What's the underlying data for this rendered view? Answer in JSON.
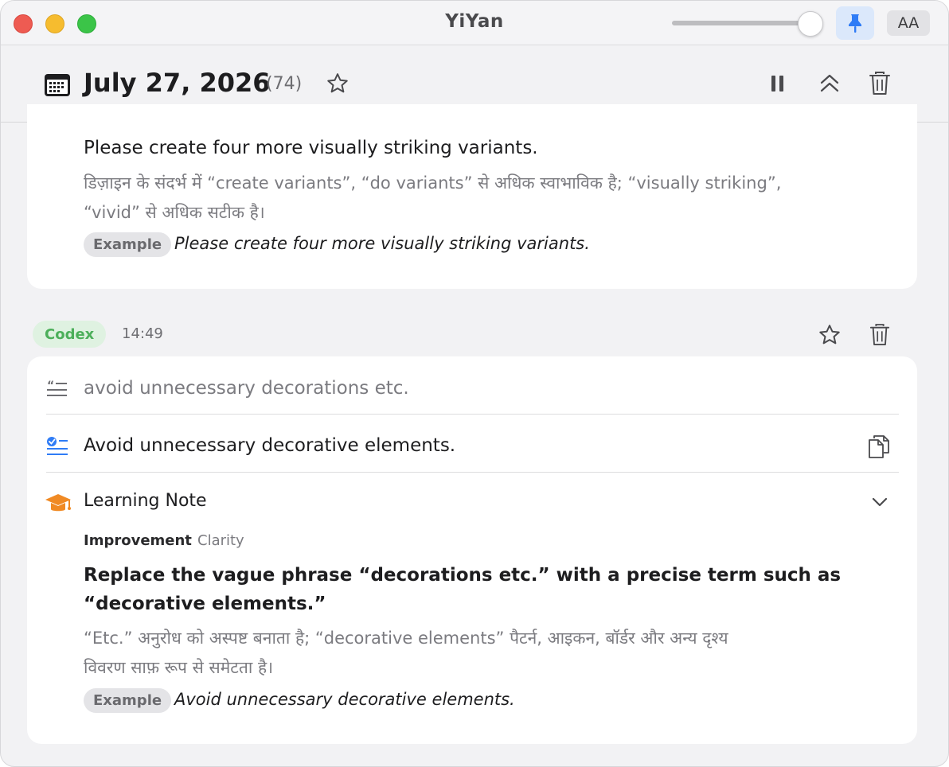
{
  "window": {
    "title": "YiYan"
  },
  "header": {
    "date": "July 27, 2026",
    "count": "(74)"
  },
  "previous_entry": {
    "text": "Please create four more visually striking variants.",
    "note_line1": "डिज़ाइन के संदर्भ में “create variants”, “do variants” से अधिक स्वाभाविक है; “visually striking”,",
    "note_line2": "“vivid” से अधिक सटीक है।",
    "example_badge": "Example",
    "example_text": "Please create four more visually striking variants."
  },
  "entry": {
    "source_badge": "Codex",
    "time": "14:49",
    "original_text": "avoid unnecessary decorations etc.",
    "corrected_text": "Avoid unnecessary decorative elements.",
    "learning_note": {
      "title": "Learning Note",
      "category": "Improvement",
      "subcategory": "Clarity",
      "headline_line1": "Replace the vague phrase “decorations etc.” with a precise term such as",
      "headline_line2": "“decorative elements.”",
      "explanation_line1": "“Etc.” अनुरोध को अस्पष्ट बनाता है; “decorative elements” पैटर्न, आइकन, बॉर्डर और अन्य दृश्य",
      "explanation_line2": "विवरण साफ़ रूप से समेटता है।",
      "example_badge": "Example",
      "example_text": "Avoid unnecessary decorative elements."
    }
  },
  "colors": {
    "accent_blue": "#2f7cf6",
    "codex_green": "#4caf5a",
    "learning_orange": "#f08a24"
  },
  "icons": {
    "pin": "pin-icon",
    "font_size": "font-size-icon",
    "calendar": "calendar-icon",
    "star": "star-icon",
    "pause": "pause-icon",
    "collapse": "chevron-double-up-icon",
    "trash": "trash-icon",
    "quote": "quote-icon",
    "checklist": "checklist-icon",
    "copy": "copy-icon",
    "graduation": "graduation-cap-icon",
    "chevron_down": "chevron-down-icon"
  },
  "font_button_label": "AA"
}
